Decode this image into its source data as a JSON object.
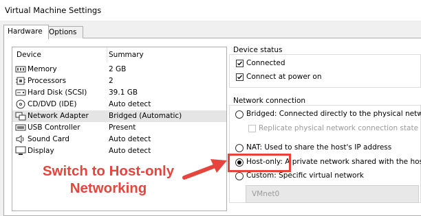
{
  "window": {
    "title": "Virtual Machine Settings"
  },
  "tabs": [
    {
      "label": "Hardware",
      "active": true
    },
    {
      "label": "Options",
      "active": false
    }
  ],
  "devices": {
    "headers": {
      "device": "Device",
      "summary": "Summary"
    },
    "rows": [
      {
        "device": "Memory",
        "summary": "2 GB",
        "icon": "memory-icon",
        "selected": false
      },
      {
        "device": "Processors",
        "summary": "2",
        "icon": "processor-icon",
        "selected": false
      },
      {
        "device": "Hard Disk (SCSI)",
        "summary": "39.1 GB",
        "icon": "hard-disk-icon",
        "selected": false
      },
      {
        "device": "CD/DVD (IDE)",
        "summary": "Auto detect",
        "icon": "cd-dvd-icon",
        "selected": false
      },
      {
        "device": "Network Adapter",
        "summary": "Bridged (Automatic)",
        "icon": "network-adapter-icon",
        "selected": true
      },
      {
        "device": "USB Controller",
        "summary": "Present",
        "icon": "usb-icon",
        "selected": false
      },
      {
        "device": "Sound Card",
        "summary": "Auto detect",
        "icon": "sound-card-icon",
        "selected": false
      },
      {
        "device": "Display",
        "summary": "Auto detect",
        "icon": "display-icon",
        "selected": false
      }
    ]
  },
  "device_status": {
    "label": "Device status",
    "connected": {
      "label": "Connected",
      "checked": true
    },
    "connect_at_power_on": {
      "label": "Connect at power on",
      "checked": true
    }
  },
  "network_connection": {
    "label": "Network connection",
    "bridged": {
      "label": "Bridged: Connected directly to the physical network",
      "selected": false
    },
    "replicate": {
      "label": "Replicate physical network connection state",
      "checked": false,
      "enabled": false
    },
    "nat": {
      "label": "NAT: Used to share the host's IP address",
      "selected": false
    },
    "host_only": {
      "label": "Host-only: A private network shared with the host",
      "selected": true
    },
    "custom": {
      "label": "Custom: Specific virtual network",
      "selected": false
    },
    "custom_select": {
      "value": "VMnet0",
      "enabled": false
    }
  },
  "annotation": {
    "line1": "Switch to Host-only",
    "line2": "Networking",
    "color": "#e5453c"
  }
}
